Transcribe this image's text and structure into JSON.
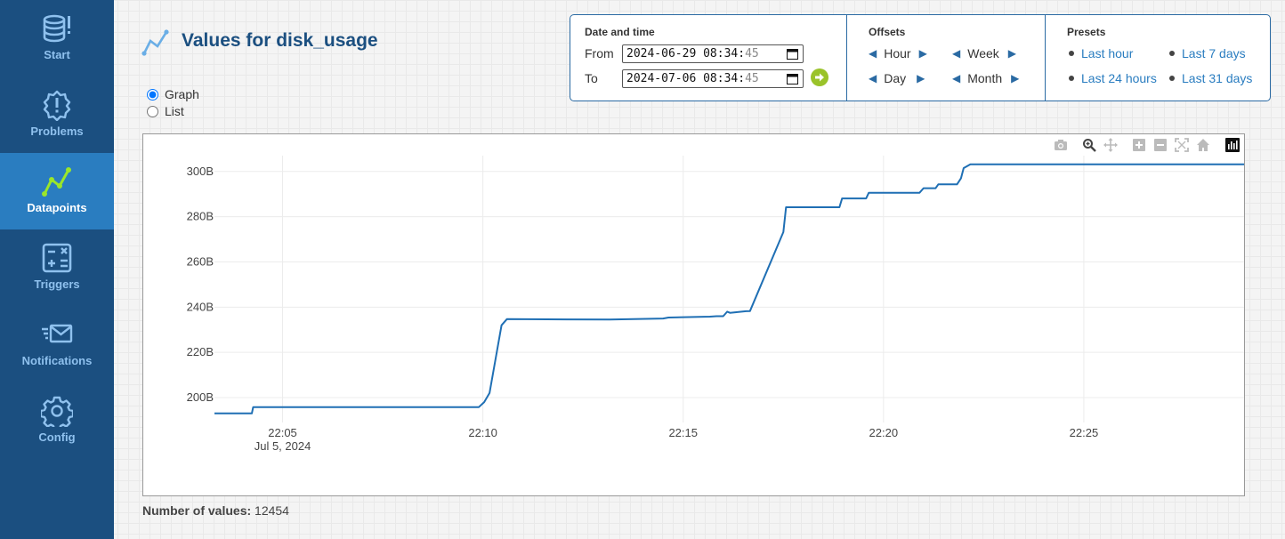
{
  "sidebar": {
    "items": [
      {
        "label": "Start",
        "icon": "database-alert-icon"
      },
      {
        "label": "Problems",
        "icon": "alert-badge-icon"
      },
      {
        "label": "Datapoints",
        "icon": "chart-line-icon",
        "active": true
      },
      {
        "label": "Triggers",
        "icon": "calculator-icon"
      },
      {
        "label": "Notifications",
        "icon": "mail-fast-icon"
      },
      {
        "label": "Config",
        "icon": "gear-icon"
      }
    ],
    "colors": {
      "background": "#1b4f80",
      "active": "#2a7dc0",
      "text": "#8fc1ee",
      "datapoints_icon": "#9ae62a"
    }
  },
  "header": {
    "title": "Values for disk_usage",
    "view_options": [
      {
        "label": "Graph",
        "checked": true
      },
      {
        "label": "List",
        "checked": false
      }
    ]
  },
  "date_panel": {
    "heading": "Date and time",
    "from_label": "From",
    "from_value": "2024-06-29 08:34:",
    "from_seconds": "45",
    "to_label": "To",
    "to_value": "2024-07-06 08:34:",
    "to_seconds": "45"
  },
  "offsets": {
    "heading": "Offsets",
    "items": [
      "Hour",
      "Week",
      "Day",
      "Month"
    ]
  },
  "presets": {
    "heading": "Presets",
    "items": [
      "Last hour",
      "Last 7 days",
      "Last 24 hours",
      "Last 31 days"
    ]
  },
  "chart_data": {
    "type": "line",
    "title": "",
    "xlabel": "",
    "ylabel": "",
    "x_ticks": [
      "22:05",
      "22:10",
      "22:15",
      "22:20",
      "22:25"
    ],
    "x_date_label": "Jul 5, 2024",
    "y_ticks": [
      "200B",
      "220B",
      "240B",
      "260B",
      "280B",
      "300B"
    ],
    "ylim": [
      189,
      307
    ],
    "xlim": [
      "22:03:18",
      "22:29:00"
    ],
    "grid": true,
    "series": [
      {
        "color": "#1f6fb4",
        "x": [
          "22:03:18",
          "22:04:14",
          "22:04:16",
          "22:09:54",
          "22:10:02",
          "22:10:10",
          "22:10:16",
          "22:10:22",
          "22:10:28",
          "22:10:36",
          "22:13:10",
          "22:14:30",
          "22:14:38",
          "22:15:40",
          "22:15:50",
          "22:16:00",
          "22:16:06",
          "22:16:10",
          "22:16:34",
          "22:16:40",
          "22:17:30",
          "22:17:34",
          "22:18:54",
          "22:18:58",
          "22:19:34",
          "22:19:38",
          "22:20:54",
          "22:21:00",
          "22:21:18",
          "22:21:22",
          "22:21:50",
          "22:21:56",
          "22:22:00",
          "22:22:10",
          "22:29:00"
        ],
        "y": [
          193.0,
          193.0,
          195.8,
          195.8,
          198,
          202,
          212,
          222,
          232,
          234.7,
          234.5,
          235.0,
          235.4,
          235.8,
          236.0,
          236.0,
          238.0,
          237.5,
          238.2,
          238.3,
          273.2,
          284.2,
          284.2,
          288.1,
          288.1,
          290.6,
          290.6,
          292.6,
          292.6,
          294.3,
          294.3,
          297,
          301.5,
          303.2,
          303.2
        ]
      }
    ]
  },
  "chart_toolbar": {
    "icons": [
      "camera-icon",
      "zoom-icon",
      "pan-icon",
      "zoom-in-icon",
      "zoom-out-icon",
      "autoscale-icon",
      "reset-axes-icon",
      "plotly-logo-icon"
    ]
  },
  "footer": {
    "label": "Number of values:",
    "value": "12454"
  }
}
